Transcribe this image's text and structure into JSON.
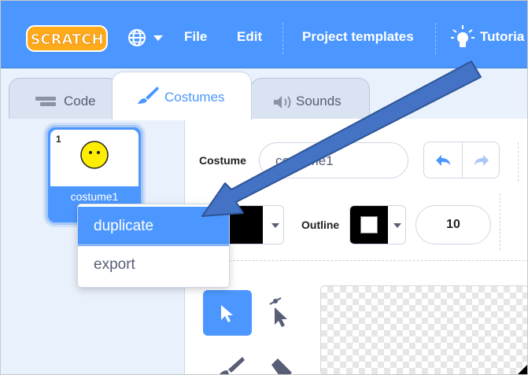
{
  "menubar": {
    "logo_text": "SCRATCH",
    "items": [
      {
        "label": "File"
      },
      {
        "label": "Edit"
      },
      {
        "label": "Project templates"
      },
      {
        "label": "Tutoria"
      }
    ],
    "icons": [
      "globe-icon",
      "lightbulb-icon"
    ]
  },
  "tabs": [
    {
      "label": "Code",
      "icon": "code-blocks-icon",
      "active": false
    },
    {
      "label": "Costumes",
      "icon": "paintbrush-icon",
      "active": true
    },
    {
      "label": "Sounds",
      "icon": "speaker-icon",
      "active": false
    }
  ],
  "costume_list": {
    "items": [
      {
        "number": "1",
        "name": "costume1"
      }
    ]
  },
  "context_menu": {
    "items": [
      {
        "label": "duplicate",
        "highlighted": true
      },
      {
        "label": "export",
        "highlighted": false
      }
    ]
  },
  "editor": {
    "costume_label": "Costume",
    "costume_name": "costume1",
    "outline_label": "Outline",
    "outline_width": "10",
    "tools": [
      "select-tool-icon",
      "reshape-tool-icon",
      "brush-tool-icon",
      "eraser-tool-icon"
    ]
  },
  "annotation": {
    "arrow_color": "#4472c4",
    "points_to": "duplicate"
  },
  "colors": {
    "menubar": "#4c97ff",
    "accent": "#4c97ff",
    "fill_color": "#000000",
    "outline_color": "#000000"
  }
}
